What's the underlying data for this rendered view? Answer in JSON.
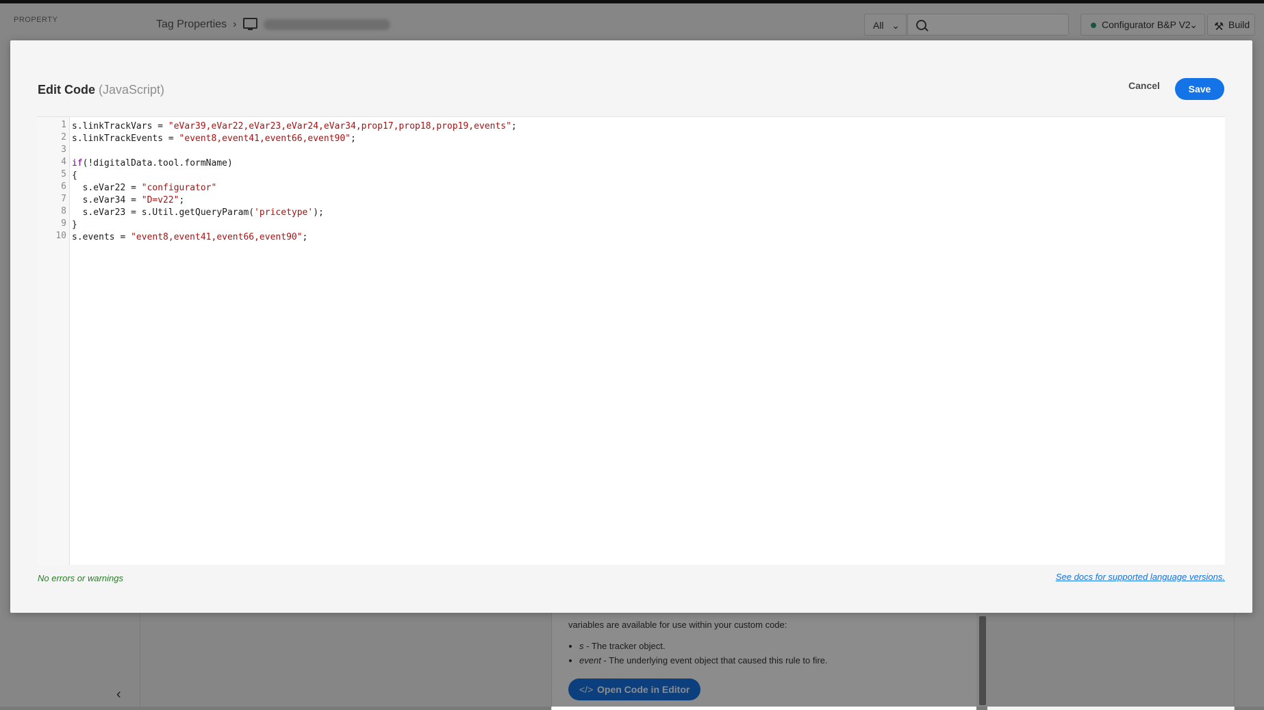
{
  "background": {
    "property_label": "PROPERTY",
    "breadcrumb": {
      "root": "Tag Properties",
      "separator": "›"
    },
    "filter": {
      "value": "All"
    },
    "search": {
      "placeholder": ""
    },
    "library": {
      "label": "Configurator B&P V2",
      "status_color": "#2d9d78"
    },
    "build_label": "Build",
    "info_text": "variables are available for use within your custom code:",
    "vars": [
      {
        "name": "s",
        "desc": " - The tracker object."
      },
      {
        "name": "event",
        "desc": " - The underlying event object that caused this rule to fire."
      }
    ],
    "open_editor_label": "Open Code in Editor"
  },
  "dialog": {
    "title": "Edit Code",
    "language": "(JavaScript)",
    "cancel_label": "Cancel",
    "save_label": "Save",
    "status": "No errors or warnings",
    "docs_link": "See docs for supported language versions."
  },
  "code": {
    "line_numbers": [
      "1",
      "2",
      "3",
      "4",
      "5",
      "6",
      "7",
      "8",
      "9",
      "10"
    ],
    "l1": {
      "a": "s.linkTrackVars = ",
      "b": "\"eVar39,eVar22,eVar23,eVar24,eVar34,prop17,prop18,prop19,events\"",
      "c": ";"
    },
    "l2": {
      "a": "s.linkTrackEvents = ",
      "b": "\"event8,event41,event66,event90\"",
      "c": ";"
    },
    "l4": {
      "kw": "if",
      "rest": "(!digitalData.tool.formName)"
    },
    "l5": "{",
    "l6": {
      "a": "  s.eVar22 = ",
      "b": "\"configurator\""
    },
    "l7": {
      "a": "  s.eVar34 = ",
      "b": "\"D=v22\"",
      "c": ";"
    },
    "l8": {
      "a": "  s.eVar23 = s.Util.getQueryParam(",
      "b": "'pricetype'",
      "c": ");"
    },
    "l9": "}",
    "l10": {
      "a": "s.events = ",
      "b": "\"event8,event41,event66,event90\"",
      "c": ";"
    }
  },
  "colors": {
    "accent": "#1473e6",
    "string": "#a11111",
    "keyword": "#770088",
    "ok": "#2b7a2b"
  }
}
